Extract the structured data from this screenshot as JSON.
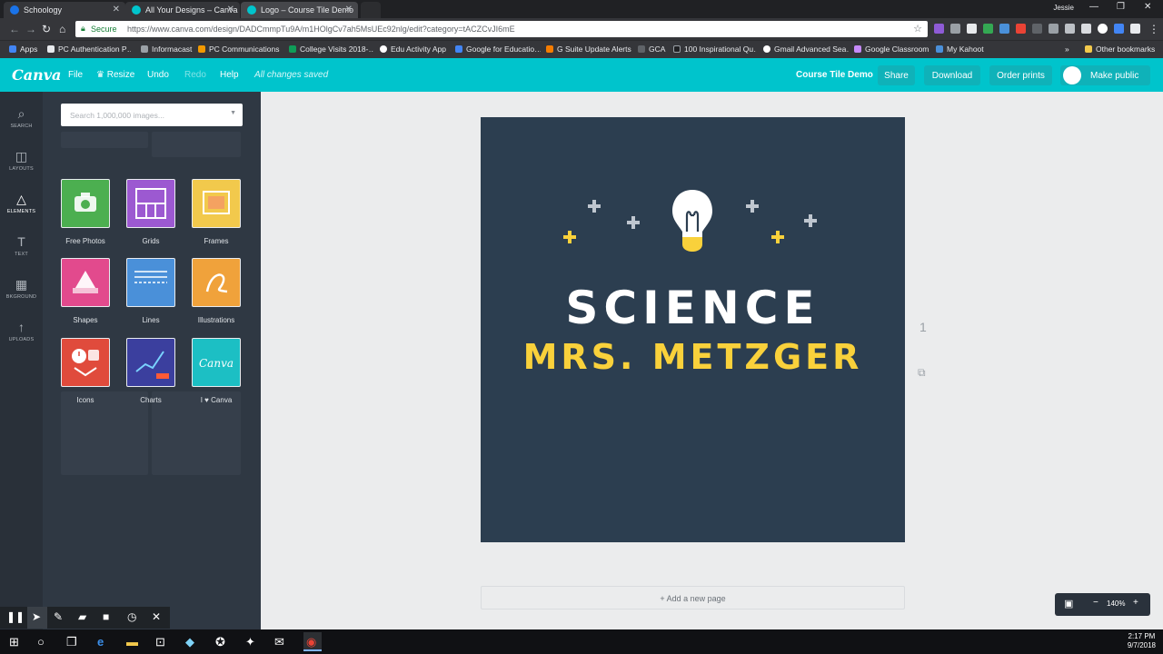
{
  "browser": {
    "tabs": [
      {
        "title": "Schoology",
        "color": "#1a73e8"
      },
      {
        "title": "All Your Designs – Canva",
        "color": "#00c4cc"
      },
      {
        "title": "Logo – Course Tile Demo",
        "color": "#00c4cc"
      }
    ],
    "user": "Jessie",
    "secure_label": "Secure",
    "url": "https://www.canva.com/design/DADCmmpTu9A/m1HOlgCv7ah5MsUEc92nlg/edit?category=tACZCvJI6mE",
    "bookmarks": [
      "Apps",
      "PC Authentication P…",
      "Informacast",
      "PC Communications",
      "College Visits 2018-…",
      "Edu Activity App",
      "Google for Educatio…",
      "G Suite Update Alerts",
      "GCA",
      "100 Inspirational Qu…",
      "Gmail Advanced Sea…",
      "Google Classroom",
      "My Kahoot"
    ],
    "more_bookmarks": "»",
    "other_bookmarks": "Other bookmarks"
  },
  "toolbar": {
    "logo": "Canva",
    "file": "File",
    "resize": "Resize",
    "undo": "Undo",
    "redo": "Redo",
    "help": "Help",
    "status": "All changes saved",
    "design_title": "Course Tile Demo",
    "share": "Share",
    "download": "Download",
    "order_prints": "Order prints",
    "make_public": "Make public"
  },
  "rail": [
    {
      "label": "SEARCH",
      "icon": "search-icon"
    },
    {
      "label": "LAYOUTS",
      "icon": "layouts-icon"
    },
    {
      "label": "ELEMENTS",
      "icon": "elements-icon"
    },
    {
      "label": "TEXT",
      "icon": "text-icon"
    },
    {
      "label": "BKGROUND",
      "icon": "background-icon"
    },
    {
      "label": "UPLOADS",
      "icon": "uploads-icon"
    }
  ],
  "panel": {
    "search_placeholder": "Search 1,000,000 images...",
    "categories": [
      {
        "label": "Free Photos",
        "color": "#4caf50"
      },
      {
        "label": "Grids",
        "color": "#9c59d1"
      },
      {
        "label": "Frames",
        "color": "#f2c94c"
      },
      {
        "label": "Shapes",
        "color": "#e24a8d"
      },
      {
        "label": "Lines",
        "color": "#4a90d9"
      },
      {
        "label": "Illustrations",
        "color": "#f0a23b"
      },
      {
        "label": "Icons",
        "color": "#e04b3c"
      },
      {
        "label": "Charts",
        "color": "#3b3f9e"
      },
      {
        "label": "I ♥ Canva",
        "color": "#1cbfc4"
      }
    ]
  },
  "canvas": {
    "title": "SCIENCE",
    "subtitle": "MRS. METZGER",
    "background": "#2c3e50",
    "accent": "#f9d13b",
    "page_number": "1",
    "add_page": "+ Add a new page"
  },
  "zoom": {
    "level": "140%",
    "minus": "−",
    "plus": "+"
  },
  "clock": {
    "time": "2:17 PM",
    "date": "9/7/2018"
  }
}
